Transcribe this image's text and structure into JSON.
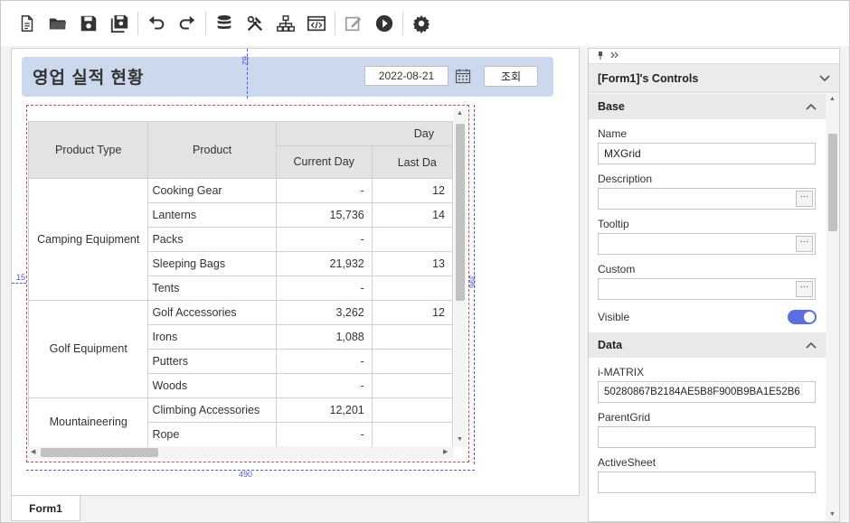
{
  "toolbar": {
    "icons": [
      "new-file-icon",
      "open-folder-icon",
      "save-icon",
      "save-all-icon",
      "undo-icon",
      "redo-icon",
      "database-icon",
      "tools-icon",
      "hierarchy-icon",
      "code-icon",
      "edit-icon",
      "run-icon",
      "settings-icon"
    ]
  },
  "designer": {
    "title": "영업 실적 현황",
    "date_value": "2022-08-21",
    "search_label": "조회",
    "guide_top": "62",
    "guide_left": "15",
    "guide_right": "396",
    "guide_bottom": "490",
    "tab_label": "Form1"
  },
  "grid": {
    "headers": {
      "product_type": "Product Type",
      "product": "Product",
      "day": "Day",
      "current_day": "Current Day",
      "last_day": "Last Da"
    },
    "groups": [
      {
        "type": "Camping Equipment",
        "rows": [
          {
            "product": "Cooking Gear",
            "current": "-",
            "last": "12"
          },
          {
            "product": "Lanterns",
            "current": "15,736",
            "last": "14"
          },
          {
            "product": "Packs",
            "current": "-",
            "last": ""
          },
          {
            "product": "Sleeping Bags",
            "current": "21,932",
            "last": "13"
          },
          {
            "product": "Tents",
            "current": "-",
            "last": ""
          }
        ]
      },
      {
        "type": "Golf Equipment",
        "rows": [
          {
            "product": "Golf Accessories",
            "current": "3,262",
            "last": "12"
          },
          {
            "product": "Irons",
            "current": "1,088",
            "last": ""
          },
          {
            "product": "Putters",
            "current": "-",
            "last": ""
          },
          {
            "product": "Woods",
            "current": "-",
            "last": ""
          }
        ]
      },
      {
        "type": "Mountaineering",
        "rows": [
          {
            "product": "Climbing Accessories",
            "current": "12,201",
            "last": ""
          },
          {
            "product": "Rope",
            "current": "-",
            "last": ""
          }
        ]
      }
    ]
  },
  "props": {
    "title": "[Form1]'s Controls",
    "base_section": "Base",
    "name_label": "Name",
    "name_value": "MXGrid",
    "description_label": "Description",
    "tooltip_label": "Tooltip",
    "custom_label": "Custom",
    "visible_label": "Visible",
    "data_section": "Data",
    "imatrix_label": "i-MATRIX",
    "imatrix_value": "50280867B2184AE5B8F900B9BA1E52B6",
    "parentgrid_label": "ParentGrid",
    "activesheet_label": "ActiveSheet",
    "ellipsis": "···"
  }
}
